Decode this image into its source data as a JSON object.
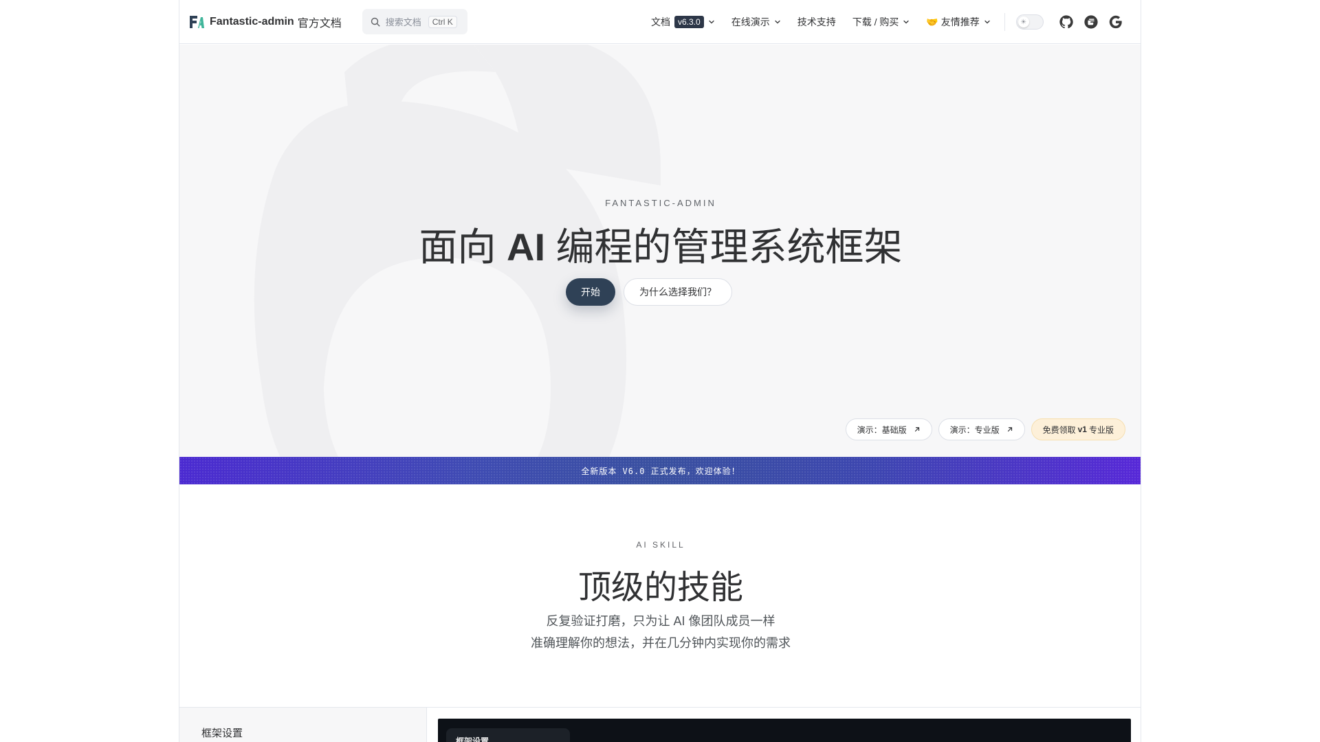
{
  "header": {
    "brand_name": "Fantastic-admin",
    "brand_suffix": "官方文档",
    "search_placeholder": "搜索文档",
    "search_shortcut": "Ctrl K",
    "nav": [
      {
        "label": "文档",
        "badge": "v6.3.0",
        "has_dropdown": true
      },
      {
        "label": "在线演示",
        "has_dropdown": true
      },
      {
        "label": "技术支持",
        "has_dropdown": false
      },
      {
        "label": "下载 / 购买",
        "has_dropdown": true
      },
      {
        "label": "🤝 友情推荐",
        "has_dropdown": true
      }
    ],
    "theme_toggle_state": "light",
    "social_icons": [
      "github-icon",
      "gitee-icon",
      "google-icon"
    ]
  },
  "hero": {
    "eyebrow": "FANTASTIC-ADMIN",
    "title_prefix": "面向 ",
    "title_bold": "AI",
    "title_suffix": " 编程的管理系统框架",
    "primary_button": "开始",
    "secondary_button": "为什么选择我们？",
    "chips": {
      "demo_basic": "演示：基础版",
      "demo_pro": "演示：专业版",
      "free_prefix": "免费领取",
      "free_bold": "v1",
      "free_suffix": "专业版"
    },
    "background_glyph": "6"
  },
  "banner": {
    "text": "全新版本 V6.0 正式发布，欢迎体验！"
  },
  "skills": {
    "eyebrow": "AI SKILL",
    "title": "顶级的技能",
    "subtitle_line1": "反复验证打磨，只为让 AI 像团队成员一样",
    "subtitle_line2": "准确理解你的想法，并在几分钟内实现你的需求"
  },
  "lower": {
    "sidebar_label": "框架设置",
    "preview_tab_label": "框架设置"
  },
  "colors": {
    "primary": "#2f4156",
    "hero_bg": "#f7f7f8",
    "banner_start": "#4b2ad1",
    "banner_end": "#5728d8",
    "gold_chip": "#fdf0d9"
  }
}
